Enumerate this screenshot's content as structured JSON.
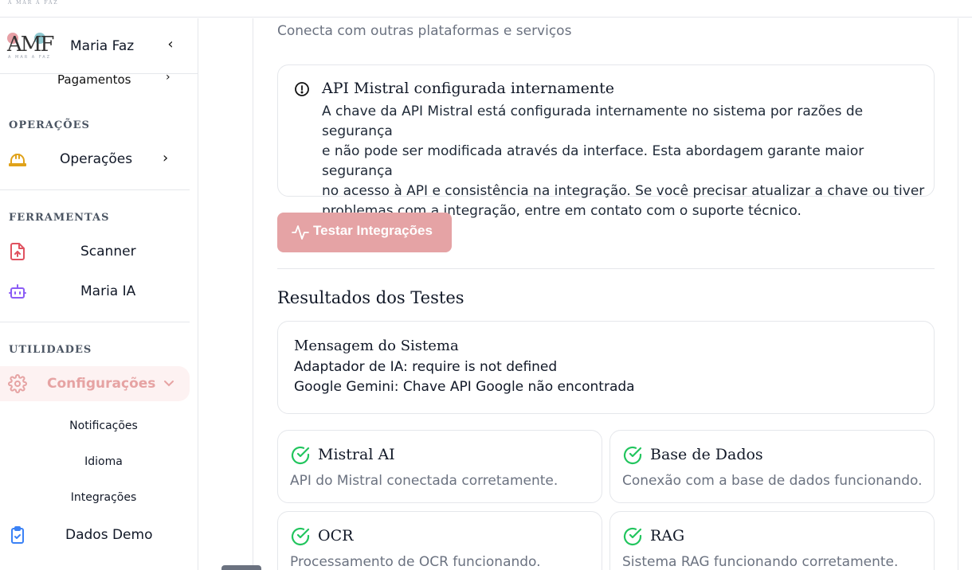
{
  "topbar": {
    "brand_small": "A MAR A FAZ"
  },
  "sidebar": {
    "logo_letters": "AMF",
    "logo_sub": "A MAR A FAZ",
    "title": "Maria Faz",
    "collapse_icon": "chevron-left-icon",
    "cut_item_label": "Pagamentos",
    "sections": {
      "operacoes": "OPERAÇÕES",
      "ferramentas": "FERRAMENTAS",
      "utilidades": "UTILIDADES"
    },
    "items": {
      "operacoes": {
        "label": "Operações",
        "icon": "hard-hat-icon"
      },
      "scanner": {
        "label": "Scanner",
        "icon": "file-upload-icon"
      },
      "maria_ia": {
        "label": "Maria IA",
        "icon": "bot-icon"
      },
      "configuracoes": {
        "label": "Configurações",
        "icon": "gear-icon"
      },
      "dados_demo": {
        "label": "Dados Demo",
        "icon": "clipboard-check-icon"
      }
    },
    "sub_items": {
      "notificacoes": "Notificações",
      "idioma": "Idioma",
      "integracoes": "Integrações"
    }
  },
  "main": {
    "subtitle": "Conecta com outras plataformas e serviços",
    "info": {
      "title": "API Mistral configurada internamente",
      "lines": [
        "A chave da API Mistral está configurada internamente no sistema por razões de segurança",
        "e não pode ser modificada através da interface. Esta abordagem garante maior segurança",
        "no acesso à API e consistência na integração. Se você precisar atualizar a chave ou tiver",
        "problemas com a integração, entre em contato com o suporte técnico."
      ]
    },
    "test_button": "Testar Integrações",
    "results_title": "Resultados dos Testes",
    "system_message": {
      "title": "Mensagem do Sistema",
      "lines": [
        "Adaptador de IA: require is not defined",
        "Google Gemini: Chave API Google não encontrada"
      ]
    },
    "status_cards": [
      {
        "name": "Mistral AI",
        "desc": "API do Mistral conectada corretamente."
      },
      {
        "name": "Base de Dados",
        "desc": "Conexão com a base de dados funcionando."
      },
      {
        "name": "OCR",
        "desc": "Processamento de OCR funcionando."
      },
      {
        "name": "RAG",
        "desc": "Sistema RAG funcionando corretamente."
      }
    ]
  },
  "colors": {
    "accent": "#e5a3a5",
    "success": "#22c55e",
    "operacoes_icon": "#e0a21a",
    "scanner_icon": "#e05260",
    "bot_icon": "#8b5cf6",
    "clipboard_icon": "#3b82f6"
  }
}
